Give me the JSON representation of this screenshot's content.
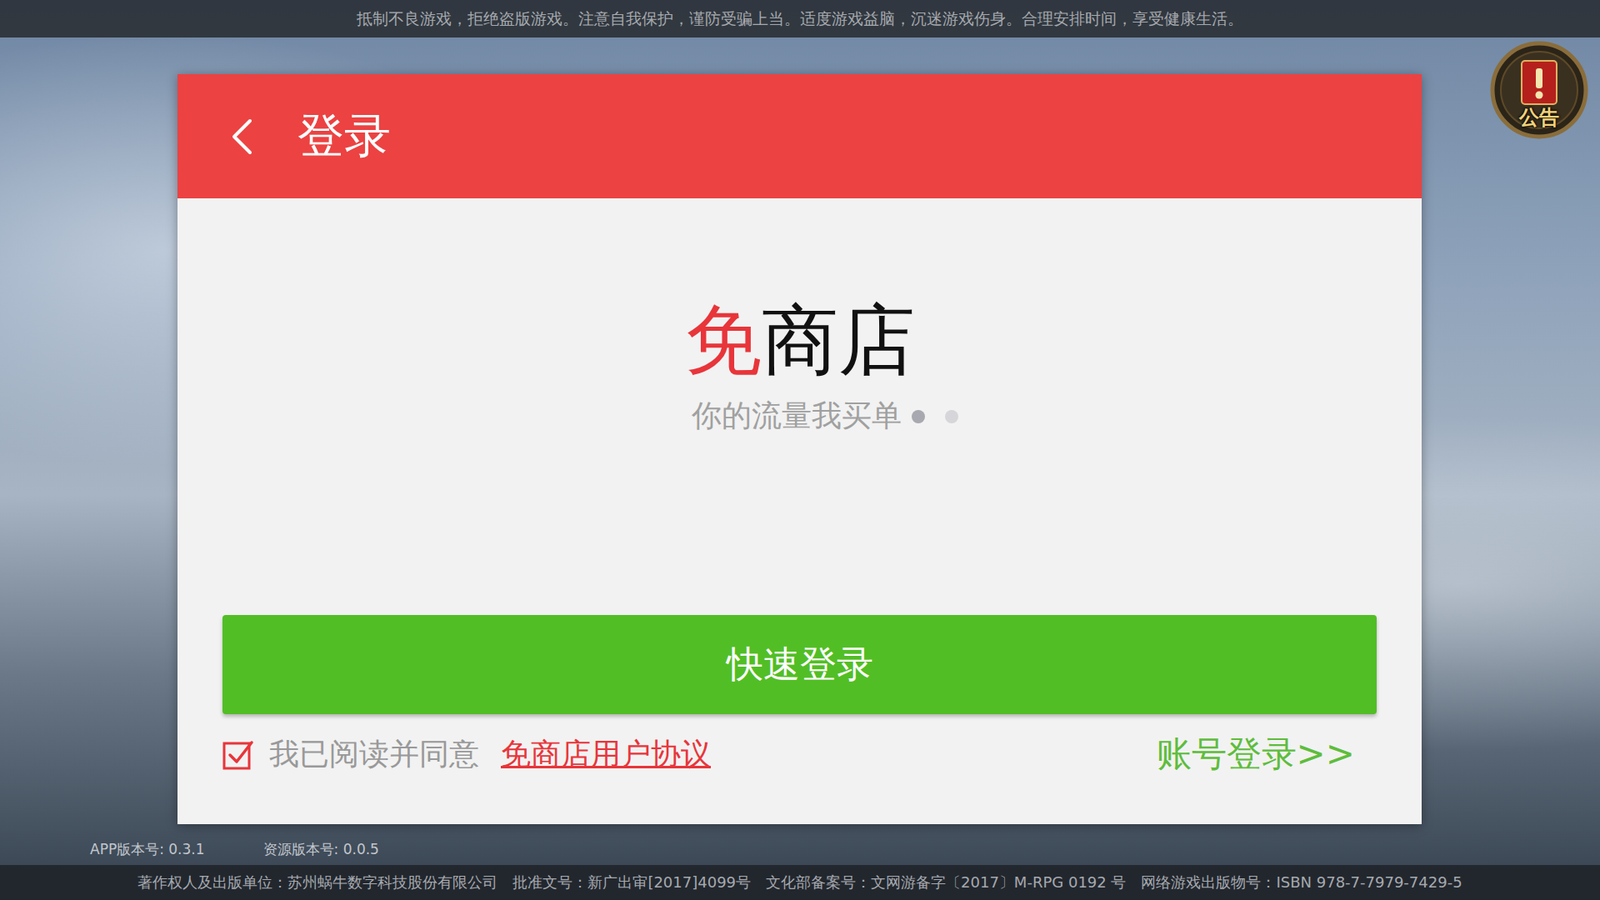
{
  "notice_bar": "抵制不良游戏，拒绝盗版游戏。注意自我保护，谨防受骗上当。适度游戏益脑，沉迷游戏伤身。合理安排时间，享受健康生活。",
  "announcement": {
    "label": "公告"
  },
  "dialog": {
    "title": "登录"
  },
  "logo": {
    "accent": "免",
    "rest": "商店"
  },
  "slogan": "你的流量我买单",
  "dots": [
    {
      "selected": true
    },
    {
      "selected": false
    }
  ],
  "quick_login": "快速登录",
  "agreement": {
    "checked": true,
    "text": "我已阅读并同意",
    "link": "免商店用户协议"
  },
  "account_login": "账号登录>>",
  "versions": [
    "APP版本号: 0.3.1",
    "资源版本号: 0.0.5"
  ],
  "footer": [
    "著作权人及出版单位：苏州蜗牛数字科技股份有限公司",
    "批准文号：新广出审[2017]4099号",
    "文化部备案号：文网游备字〔2017〕M-RPG 0192 号",
    "网络游戏出版物号：ISBN 978-7-7979-7429-5"
  ]
}
